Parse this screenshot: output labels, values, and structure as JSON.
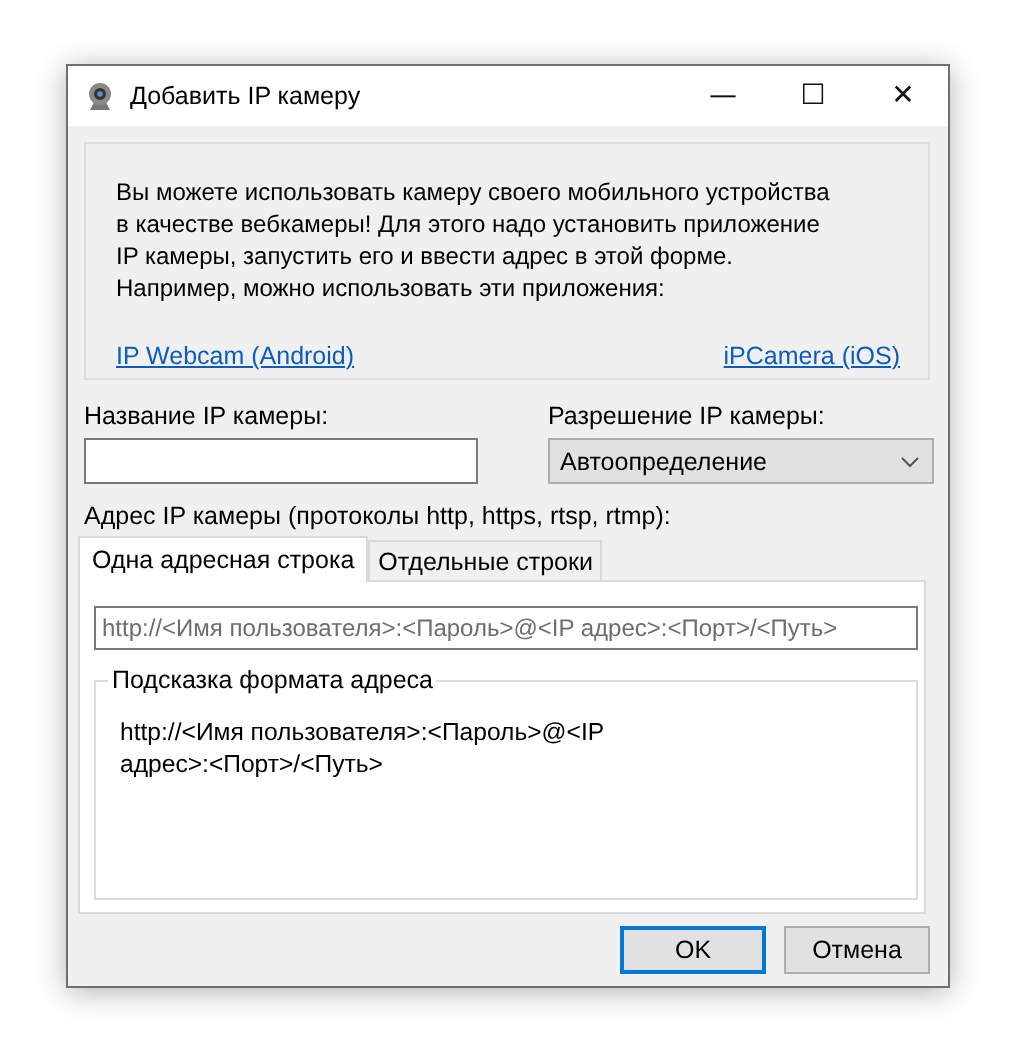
{
  "window": {
    "title": "Добавить IP камеру",
    "controls": [
      "—",
      "☐",
      "✕"
    ]
  },
  "info": {
    "text": "Вы можете использовать камеру своего мобильного устройства в качестве вебкамеры! Для этого надо установить приложение IP камеры, запустить его и ввести адрес в этой форме. Например, можно использовать эти приложения:",
    "links": [
      "IP Webcam (Android)",
      "iPCamera (iOS)"
    ]
  },
  "name_field": {
    "label": "Название IP камеры:"
  },
  "resolution": {
    "label": "Разрешение IP камеры:",
    "value": "Автоопределение"
  },
  "address_label": "Адрес IP камеры (протоколы http, https, rtsp, rtmp):",
  "tabs": [
    {
      "label": "Одна адресная строка",
      "selected": true
    },
    {
      "label": "Отдельные строки",
      "selected": false
    }
  ],
  "address_field": {
    "placeholder": "http://<Имя пользователя>:<Пароль>@<IP адрес>:<Порт>/<Путь>"
  },
  "hint": {
    "title": "Подсказка формата адреса",
    "text": "http://<Имя пользователя>:<Пароль>@<IP адрес>:<Порт>/<Путь>"
  },
  "buttons": [
    {
      "label": "OK",
      "default": true
    },
    {
      "label": "Отмена",
      "default": false
    }
  ]
}
